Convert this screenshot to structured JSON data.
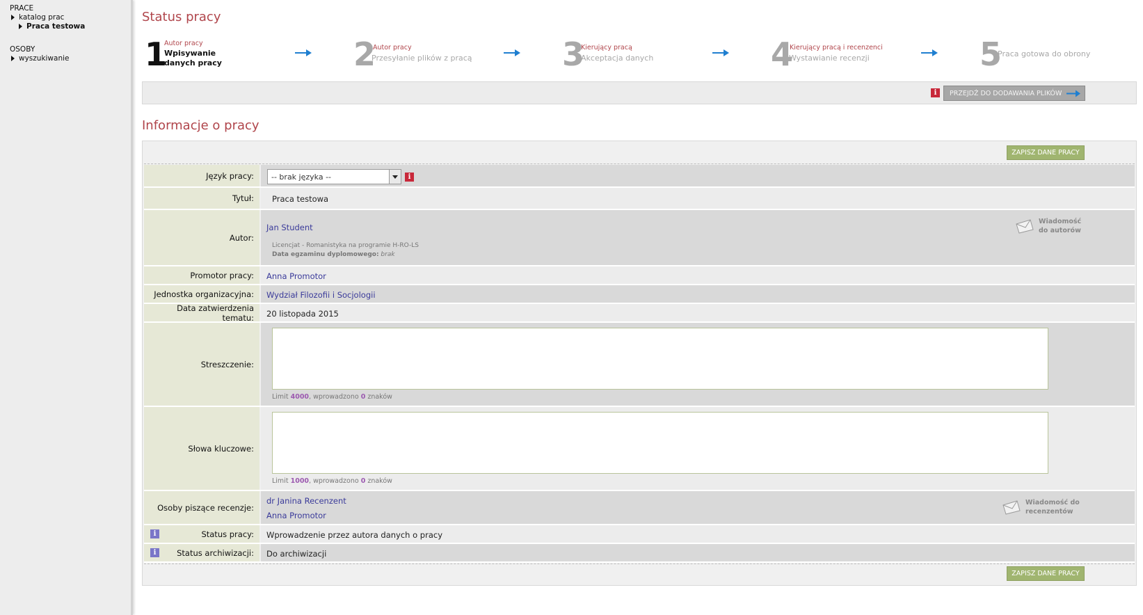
{
  "sidebar": {
    "sections": [
      {
        "title": "PRACE",
        "items": [
          {
            "label": "katalog prac"
          },
          {
            "label": "Praca testowa"
          }
        ]
      },
      {
        "title": "OSOBY",
        "items": [
          {
            "label": "wyszukiwanie"
          }
        ]
      }
    ]
  },
  "status": {
    "title": "Status pracy",
    "steps": [
      {
        "num": "1",
        "who": "Autor pracy",
        "what": "Wpisywanie danych pracy",
        "active": true
      },
      {
        "num": "2",
        "who": "Autor pracy",
        "what": "Przesyłanie plików z pracą"
      },
      {
        "num": "3",
        "who": "Kierujący pracą",
        "what": "Akceptacja danych"
      },
      {
        "num": "4",
        "who": "Kierujący pracą i recenzenci",
        "what": "Wystawianie recenzji"
      },
      {
        "num": "5",
        "who": "",
        "what": "Praca gotowa do obrony"
      }
    ],
    "next_button": "PRZEJDŹ DO DODAWANIA PLIKÓW",
    "info_glyph": "i"
  },
  "info": {
    "title": "Informacje o pracy",
    "save_button": "ZAPISZ DANE PRACY",
    "fields": {
      "language": {
        "label": "Język pracy:",
        "value": "-- brak języka --"
      },
      "title": {
        "label": "Tytuł:",
        "value": "Praca testowa"
      },
      "author": {
        "label": "Autor:",
        "name": "Jan Student",
        "program": "Licencjat - Romanistyka na programie H-RO-LS",
        "exam_label": "Data egzaminu dyplomowego:",
        "exam_value": "brak",
        "msg_line1": "Wiadomość",
        "msg_line2": "do autorów"
      },
      "promotor": {
        "label": "Promotor pracy:",
        "value": "Anna Promotor"
      },
      "unit": {
        "label": "Jednostka organizacyjna:",
        "value": "Wydział Filozofii i Socjologii"
      },
      "date": {
        "label": "Data zatwierdzenia tematu:",
        "value": "20 listopada 2015"
      },
      "abstract": {
        "label": "Streszczenie:",
        "limit_prefix": "Limit",
        "limit": "4000",
        "limit_mid": ", wprowadzono",
        "count": "0",
        "limit_suffix": "znaków"
      },
      "keywords": {
        "label": "Słowa kluczowe:",
        "limit_prefix": "Limit",
        "limit": "1000",
        "limit_mid": ", wprowadzono",
        "count": "0",
        "limit_suffix": "znaków"
      },
      "reviewers": {
        "label": "Osoby piszące recenzje:",
        "names": [
          "dr Janina Recenzent",
          "Anna Promotor"
        ],
        "msg_line1": "Wiadomość do",
        "msg_line2": "recenzentów"
      },
      "work_status": {
        "label": "Status pracy:",
        "value": "Wprowadzenie przez autora danych o pracy"
      },
      "archive_status": {
        "label": "Status archiwizacji:",
        "value": "Do archiwizacji"
      }
    }
  },
  "colors": {
    "accent": "#b0454b",
    "link": "#3a3a9a",
    "save": "#a0b570",
    "arrow": "#1f7fd0"
  }
}
